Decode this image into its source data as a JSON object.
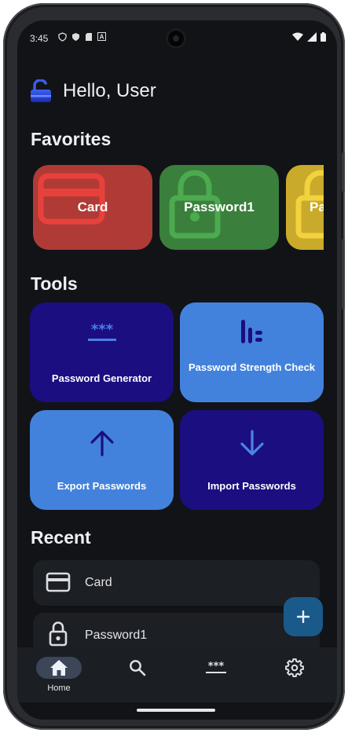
{
  "status_bar": {
    "time": "3:45"
  },
  "header": {
    "greeting": "Hello, User"
  },
  "favorites": {
    "title": "Favorites",
    "items": [
      {
        "label": "Card",
        "color": "#b03a36",
        "icon": "credit-card-icon"
      },
      {
        "label": "Password1",
        "color": "#3a7f3c",
        "icon": "lock-icon"
      },
      {
        "label": "Pa",
        "color": "#c9aa2a",
        "icon": "lock-icon"
      }
    ]
  },
  "tools": {
    "title": "Tools",
    "items": [
      {
        "label": "Password Generator",
        "icon": "password-dots-icon",
        "color": "#1a0e80"
      },
      {
        "label": "Password Strength Check",
        "icon": "strength-meter-icon",
        "color": "#4382dc"
      },
      {
        "label": "Export Passwords",
        "icon": "arrow-up-icon",
        "color": "#4382dc"
      },
      {
        "label": "Import Passwords",
        "icon": "arrow-down-icon",
        "color": "#1a0e80"
      }
    ]
  },
  "recent": {
    "title": "Recent",
    "items": [
      {
        "label": "Card",
        "icon": "credit-card-icon"
      },
      {
        "label": "Password1",
        "icon": "lock-icon"
      }
    ]
  },
  "fab": {
    "icon": "plus-icon"
  },
  "bottom_nav": {
    "items": [
      {
        "label": "Home",
        "icon": "home-icon",
        "active": true
      },
      {
        "label": "",
        "icon": "search-icon",
        "active": false
      },
      {
        "label": "",
        "icon": "password-dots-icon",
        "active": false
      },
      {
        "label": "",
        "icon": "gear-icon",
        "active": false
      }
    ]
  }
}
